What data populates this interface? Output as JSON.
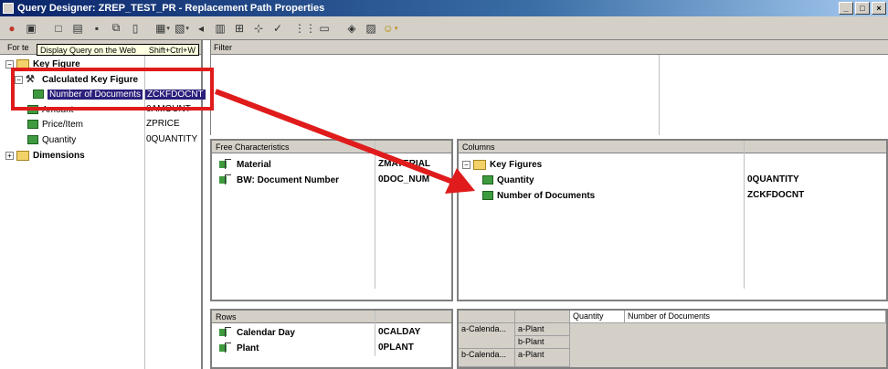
{
  "window": {
    "title": "Query Designer: ZREP_TEST_PR - Replacement Path Properties",
    "controls": [
      "_",
      "□",
      "×"
    ]
  },
  "tooltip": {
    "label": "Display Query on the Web",
    "shortcut": "Shift+Ctrl+W"
  },
  "left_pane": {
    "header_fragment": "For te",
    "tree": [
      {
        "label": "Key Figure",
        "tech": ""
      },
      {
        "label": "Calculated Key Figure",
        "tech": ""
      },
      {
        "label": "Number of Documents",
        "tech": "ZCKFDOCNT"
      },
      {
        "label": "Amount",
        "tech": "0AMOUNT"
      },
      {
        "label": "Price/Item",
        "tech": "ZPRICE"
      },
      {
        "label": "Quantity",
        "tech": "0QUANTITY"
      },
      {
        "label": "Dimensions",
        "tech": ""
      }
    ]
  },
  "filter": {
    "header": "Filter"
  },
  "free_characteristics": {
    "header": "Free Characteristics",
    "items": [
      {
        "label": "Material",
        "tech": "ZMATERIAL"
      },
      {
        "label": "BW: Document Number",
        "tech": "0DOC_NUM"
      }
    ]
  },
  "columns": {
    "header": "Columns",
    "group": "Key Figures",
    "items": [
      {
        "label": "Quantity",
        "tech": "0QUANTITY"
      },
      {
        "label": "Number of Documents",
        "tech": "ZCKFDOCNT"
      }
    ]
  },
  "rows": {
    "header": "Rows",
    "items": [
      {
        "label": "Calendar Day",
        "tech": "0CALDAY"
      },
      {
        "label": "Plant",
        "tech": "0PLANT"
      }
    ]
  },
  "preview": {
    "col_headers": [
      "Quantity",
      "Number of Documents"
    ],
    "cells": [
      "a-Calenda...",
      "a-Plant",
      "b-Plant",
      "b-Calenda...",
      "a-Plant"
    ]
  },
  "annotation": {
    "highlight_color": "#e01b1b",
    "arrow_color": "#e01b1b"
  }
}
